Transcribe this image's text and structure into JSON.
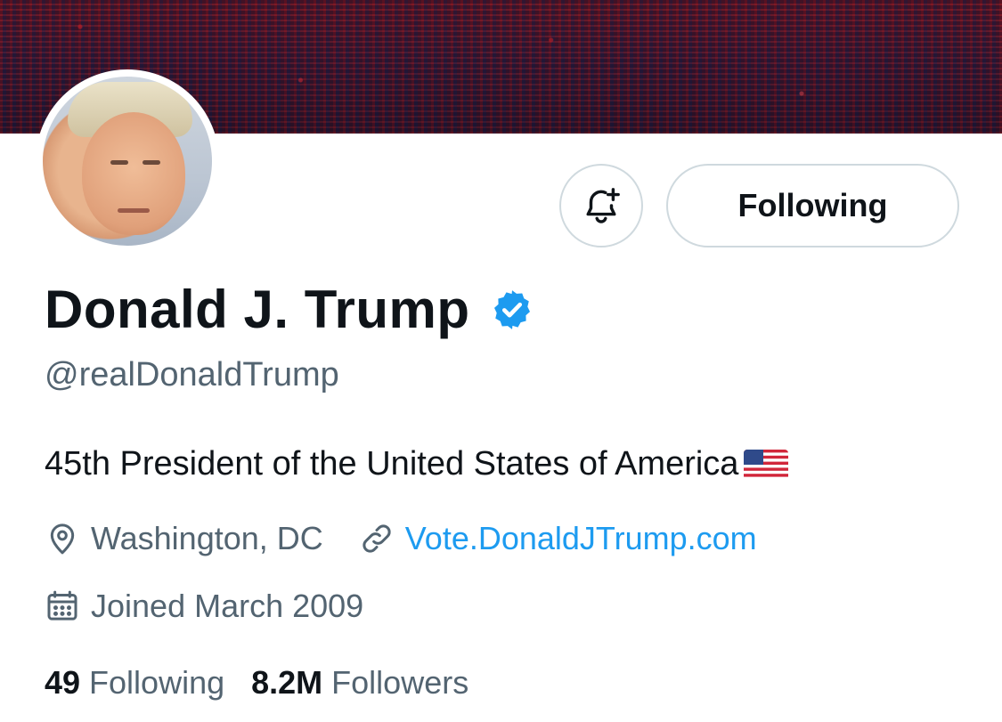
{
  "profile": {
    "name": "Donald J. Trump",
    "handle": "@realDonaldTrump",
    "bio": "45th President of the United States of America",
    "location": "Washington, DC",
    "website": "Vote.DonaldJTrump.com",
    "joined": "Joined March 2009",
    "verified": true
  },
  "actions": {
    "notify_icon": "bell-plus-icon",
    "follow_label": "Following"
  },
  "stats": {
    "following_count": "49",
    "following_label": "Following",
    "followers_count": "8.2M",
    "followers_label": "Followers"
  },
  "colors": {
    "link": "#1d9bf0",
    "secondary_text": "#536471",
    "verified_badge": "#1d9bf0",
    "border": "#cfd9de"
  }
}
